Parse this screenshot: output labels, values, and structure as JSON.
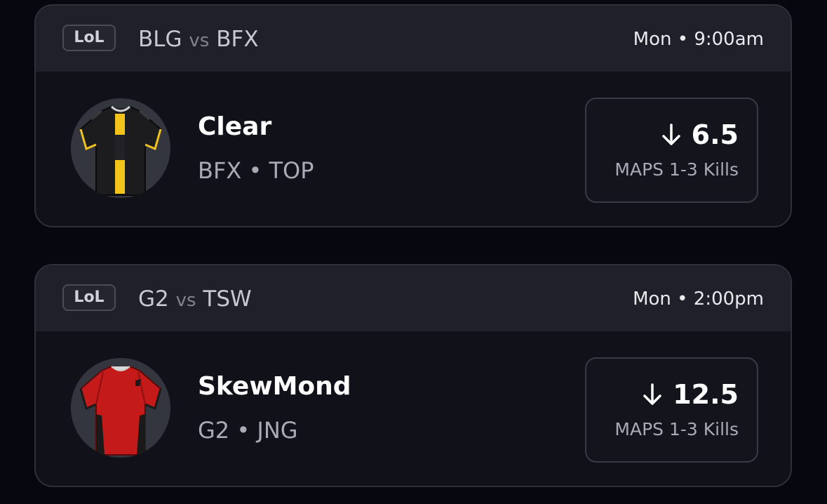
{
  "cards": [
    {
      "league": "LoL",
      "team_a": "BLG",
      "vs": "vs",
      "team_b": "BFX",
      "time": "Mon • 9:00am",
      "player": {
        "name": "Clear",
        "team": "BFX",
        "separator": "•",
        "position": "TOP",
        "avatar_icon": "black-yellow-jersey-icon",
        "jersey_colors": {
          "base": "#1c1c1e",
          "stripe": "#f2c31b"
        }
      },
      "line": {
        "direction_icon": "arrow-down-icon",
        "value": "6.5",
        "stat": "MAPS 1-3 Kills"
      }
    },
    {
      "league": "LoL",
      "team_a": "G2",
      "vs": "vs",
      "team_b": "TSW",
      "time": "Mon • 2:00pm",
      "player": {
        "name": "SkewMond",
        "team": "G2",
        "separator": "•",
        "position": "JNG",
        "avatar_icon": "red-jersey-icon",
        "jersey_colors": {
          "base": "#c41a1a",
          "trim": "#1a1a1a"
        }
      },
      "line": {
        "direction_icon": "arrow-down-icon",
        "value": "12.5",
        "stat": "MAPS 1-3 Kills"
      }
    }
  ],
  "colors": {
    "background": "#07080f",
    "card": "#111219",
    "card_header": "#1f2029",
    "border": "#2f3038",
    "muted_text": "#a9aab5"
  }
}
